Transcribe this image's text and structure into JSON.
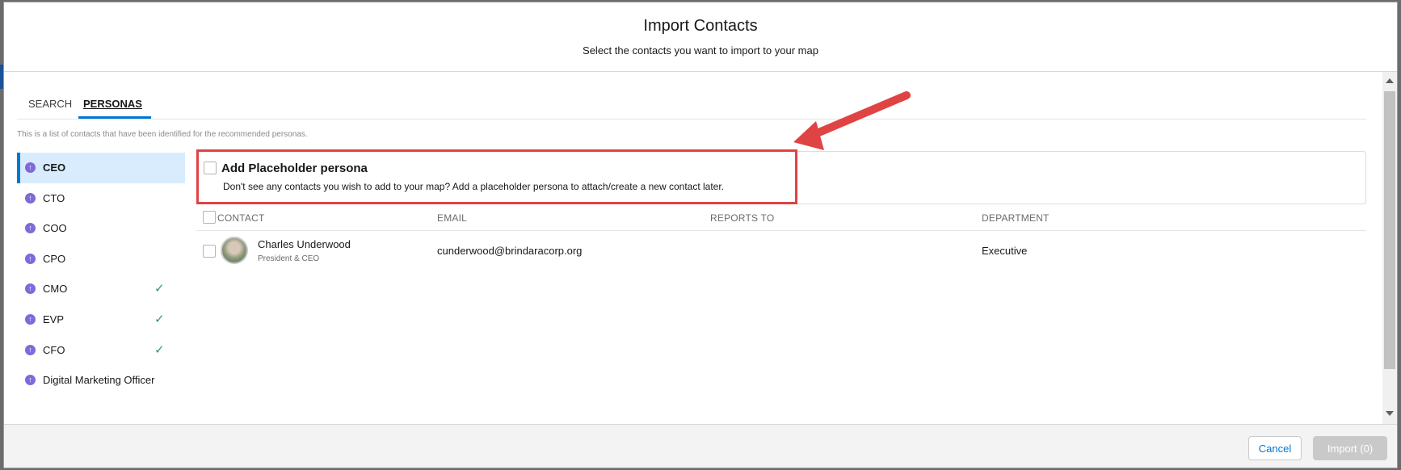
{
  "modal": {
    "title": "Import Contacts",
    "subtitle": "Select the contacts you want to import to your map"
  },
  "tabs": [
    {
      "label": "SEARCH",
      "active": false
    },
    {
      "label": "PERSONAS",
      "active": true
    }
  ],
  "description": "This is a list of contacts that have been identified for the recommended personas.",
  "personas": [
    {
      "label": "CEO",
      "active": true,
      "checked": false
    },
    {
      "label": "CTO",
      "active": false,
      "checked": false
    },
    {
      "label": "COO",
      "active": false,
      "checked": false
    },
    {
      "label": "CPO",
      "active": false,
      "checked": false
    },
    {
      "label": "CMO",
      "active": false,
      "checked": true
    },
    {
      "label": "EVP",
      "active": false,
      "checked": true
    },
    {
      "label": "CFO",
      "active": false,
      "checked": true
    },
    {
      "label": "Digital Marketing Officer",
      "active": false,
      "checked": false
    }
  ],
  "placeholder": {
    "title": "Add Placeholder persona",
    "description": "Don't see any contacts you wish to add to your map? Add a placeholder persona to attach/create a new contact later."
  },
  "table": {
    "headers": [
      "CONTACT",
      "EMAIL",
      "REPORTS TO",
      "DEPARTMENT"
    ],
    "rows": [
      {
        "name": "Charles Underwood",
        "title": "President & CEO",
        "email": "cunderwood@brindaracorp.org",
        "reports_to": "",
        "department": "Executive"
      }
    ]
  },
  "footer": {
    "cancel_label": "Cancel",
    "import_label": "Import (0)"
  },
  "colors": {
    "accent": "#0176d3",
    "highlight": "#e04343",
    "persona_icon": "#7f6ad8",
    "check": "#2e9c5a"
  },
  "icons": {
    "persona": "persona-icon",
    "check": "checkmark-icon",
    "annotation": "red-arrow-annotation"
  }
}
